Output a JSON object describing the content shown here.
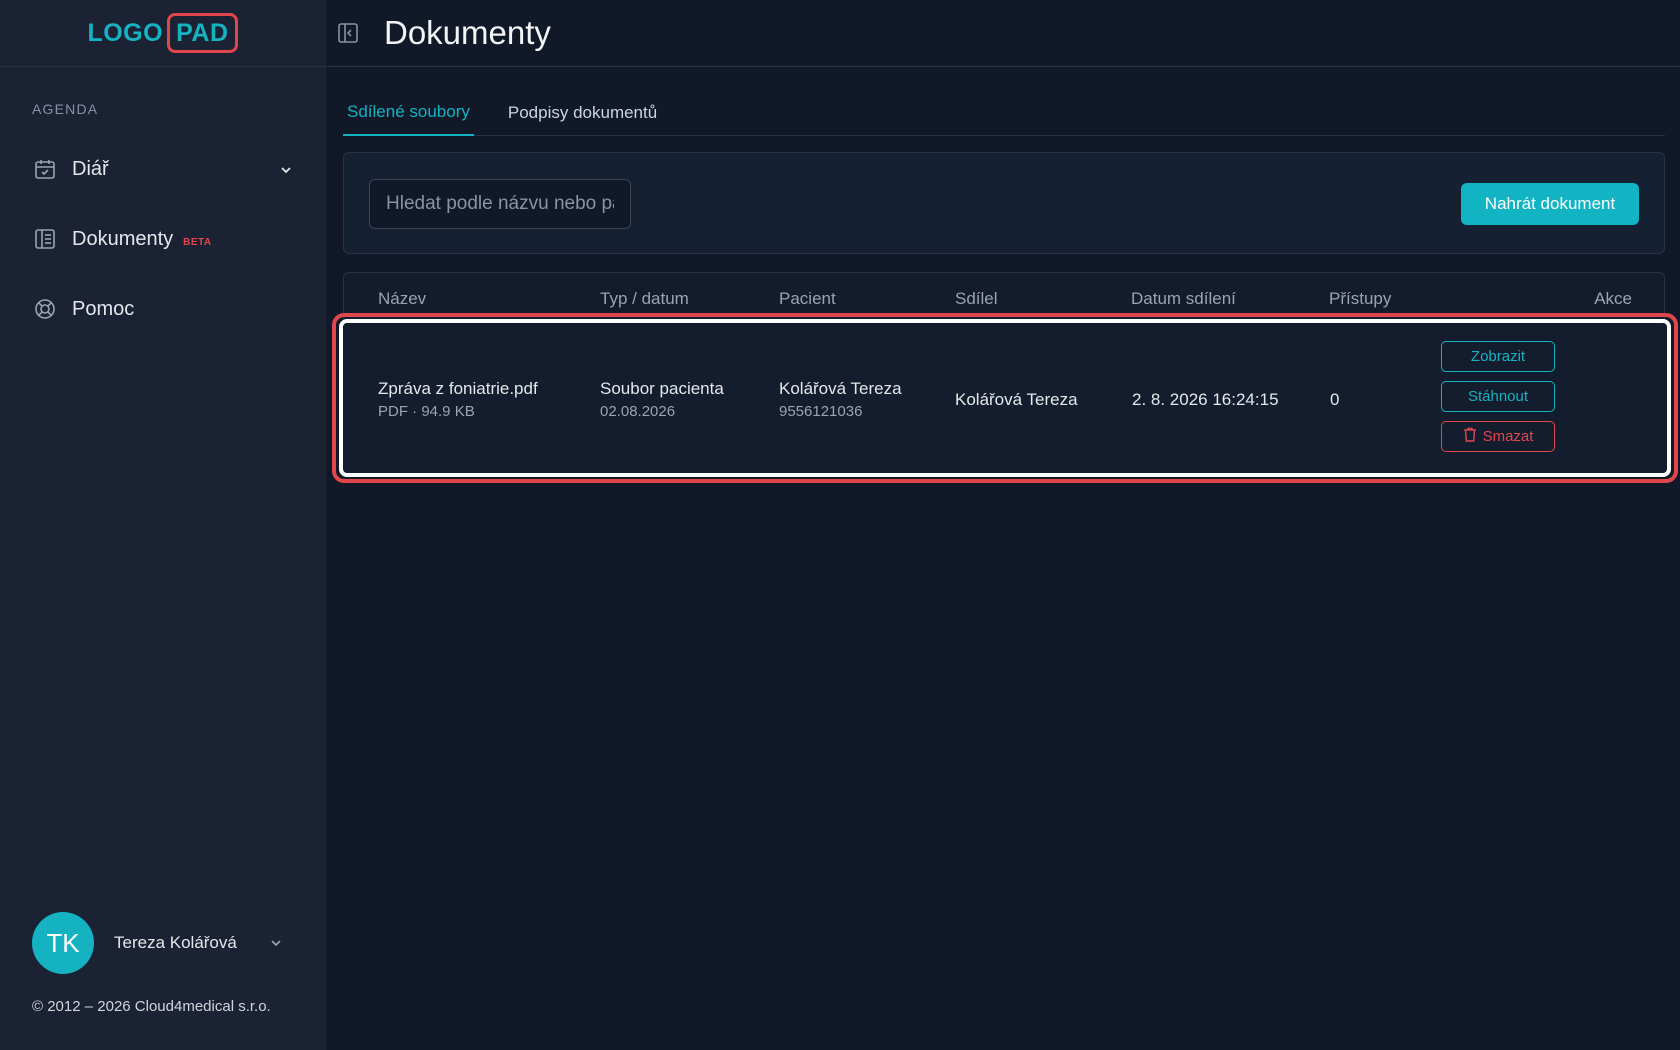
{
  "logo": {
    "part_a": "LOGO",
    "part_b": "PAD"
  },
  "sidebar": {
    "section_label": "AGENDA",
    "items": [
      {
        "label": "Diář",
        "icon": "calendar-check-icon"
      },
      {
        "label": "Dokumenty",
        "icon": "document-icon",
        "badge": "BETA"
      },
      {
        "label": "Pomoc",
        "icon": "lifebuoy-icon"
      }
    ],
    "user": {
      "initials": "TK",
      "name": "Tereza Kolářová"
    },
    "copyright": "© 2012 – 2026 Cloud4medical s.r.o."
  },
  "header": {
    "title": "Dokumenty"
  },
  "tabs": [
    {
      "label": "Sdílené soubory",
      "active": true
    },
    {
      "label": "Podpisy dokumentů",
      "active": false
    }
  ],
  "toolbar": {
    "search_placeholder": "Hledat podle názvu nebo pacienta",
    "upload_label": "Nahrát dokument"
  },
  "table": {
    "headers": [
      "Název",
      "Typ / datum",
      "Pacient",
      "Sdílel",
      "Datum sdílení",
      "Přístupy",
      "Akce"
    ],
    "rows": [
      {
        "name": "Zpráva z foniatrie.pdf",
        "name_meta": "PDF · 94.9 KB",
        "type": "Soubor pacienta",
        "type_date": "02.08.2026",
        "patient": "Kolářová Tereza",
        "patient_id": "9556121036",
        "shared_by": "Kolářová Tereza",
        "shared_at": "2. 8. 2026 16:24:15",
        "accesses": "0",
        "actions": {
          "view": "Zobrazit",
          "download": "Stáhnout",
          "delete": "Smazat"
        }
      }
    ]
  },
  "colors": {
    "accent": "#15b3c2",
    "danger": "#e0474c",
    "background": "#111827",
    "sidebar": "#1a2234"
  }
}
